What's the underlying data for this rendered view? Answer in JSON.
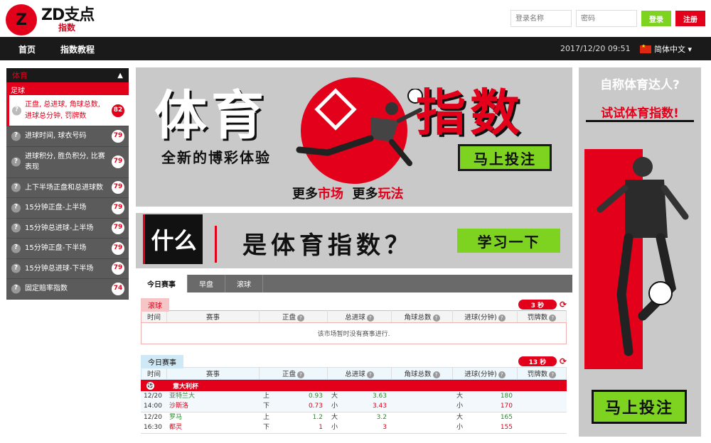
{
  "header": {
    "logo_mark": "Z",
    "logo_main": "ZD支点",
    "logo_sub": "指数",
    "username_placeholder": "登录名称",
    "password_placeholder": "密码",
    "login_label": "登录",
    "register_label": "注册"
  },
  "nav": {
    "items": [
      "首页",
      "指数教程"
    ],
    "datetime": "2017/12/20 09:51",
    "language": "简体中文 ▾"
  },
  "sidebar": {
    "category": "体育",
    "sub_category": "足球",
    "items": [
      {
        "label": "正盘, 总进球, 角球总数, 进球总分钟, 罚牌数",
        "count": "82",
        "active": true
      },
      {
        "label": "进球时间, 球衣号码",
        "count": "79"
      },
      {
        "label": "进球积分, 胜负积分, 比赛表现",
        "count": "79"
      },
      {
        "label": "上下半场正盘和总进球数",
        "count": "79"
      },
      {
        "label": "15分钟正盘-上半场",
        "count": "79"
      },
      {
        "label": "15分钟总进球-上半场",
        "count": "79"
      },
      {
        "label": "15分钟正盘-下半场",
        "count": "79"
      },
      {
        "label": "15分钟总进球-下半场",
        "count": "79"
      },
      {
        "label": "固定赔率指数",
        "count": "74"
      }
    ]
  },
  "banner1": {
    "title_left": "体育",
    "title_right": "指数",
    "subtitle": "全新的博彩体验",
    "cta": "马上投注",
    "tagline_1": "更多",
    "tagline_2": "市场",
    "tagline_3": "更多",
    "tagline_4": "玩法"
  },
  "banner2": {
    "what": "什么",
    "question": "是体育指数？",
    "cta": "学习一下"
  },
  "side_banner": {
    "line1": "自称体育达人?",
    "line2": "试试体育指数!",
    "cta": "马上投注"
  },
  "tabs": [
    "今日赛事",
    "早盘",
    "滚球"
  ],
  "live_section": {
    "label": "滚球",
    "timer": "3 秒",
    "columns": [
      "时间",
      "赛事",
      "正盘",
      "总进球",
      "角球总数",
      "进球(分钟)",
      "罚牌数"
    ],
    "empty_message": "该市场暂时没有赛事进行."
  },
  "today_section": {
    "label": "今日赛事",
    "timer": "13 秒",
    "columns": [
      "时间",
      "赛事",
      "正盘",
      "总进球",
      "角球总数",
      "进球(分钟)",
      "罚牌数"
    ],
    "league": "意大利杯",
    "matches": [
      {
        "date": "12/20",
        "time": "14:00",
        "home": "亚特兰大",
        "away": "沙斯洛",
        "hcap_up": "上",
        "hcap_up_val": "0.93",
        "hcap_down": "下",
        "hcap_down_val": "0.73",
        "goals_big": "大",
        "goals_big_val": "3.63",
        "goals_small": "小",
        "goals_small_val": "3.43",
        "min_big": "大",
        "min_big_val": "180",
        "min_small": "小",
        "min_small_val": "170"
      },
      {
        "date": "12/20",
        "time": "16:30",
        "home": "罗马",
        "away": "都灵",
        "hcap_up": "上",
        "hcap_up_val": "1.2",
        "hcap_down": "下",
        "hcap_down_val": "1",
        "goals_big": "大",
        "goals_big_val": "3.2",
        "goals_small": "小",
        "goals_small_val": "3",
        "min_big": "大",
        "min_big_val": "165",
        "min_small": "小",
        "min_small_val": "155"
      }
    ]
  },
  "colors": {
    "brand_red": "#e2001a",
    "cta_green": "#7ed321",
    "dark": "#1a1a1a"
  }
}
